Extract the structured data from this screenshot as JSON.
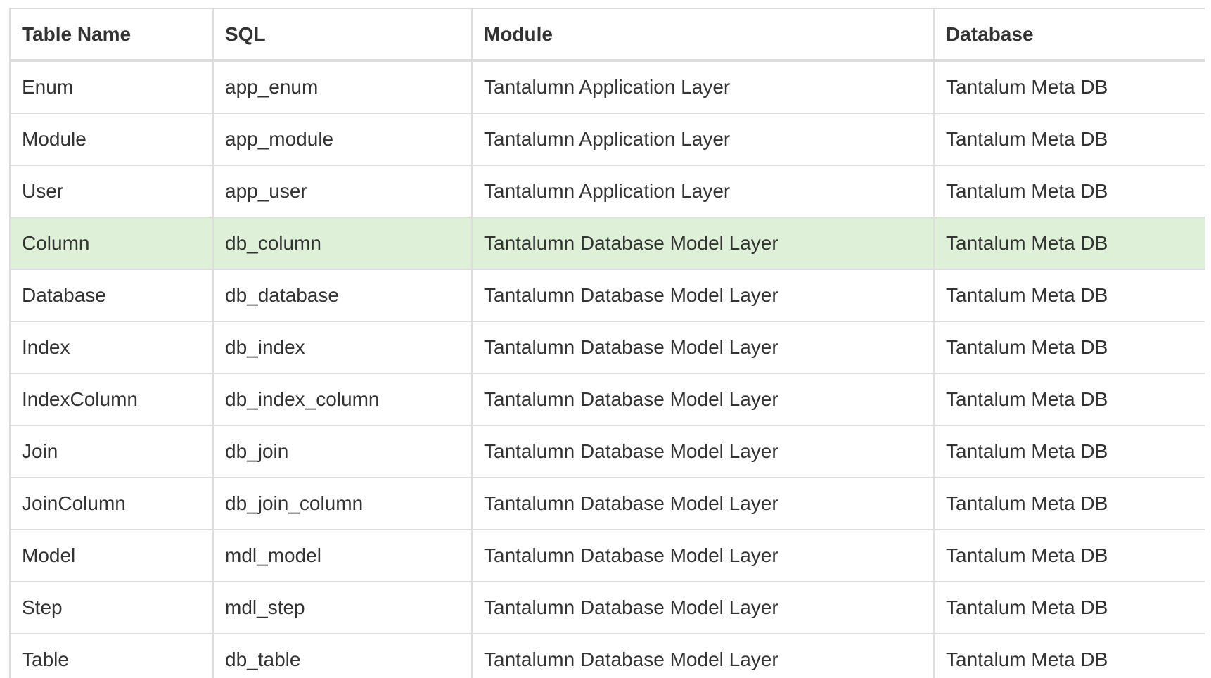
{
  "columns": {
    "table_name": "Table Name",
    "sql": "SQL",
    "module": "Module",
    "database": "Database"
  },
  "rows": [
    {
      "table_name": "Enum",
      "sql": "app_enum",
      "module": "Tantalumn Application Layer",
      "database": "Tantalum Meta DB",
      "highlighted": false
    },
    {
      "table_name": "Module",
      "sql": "app_module",
      "module": "Tantalumn Application Layer",
      "database": "Tantalum Meta DB",
      "highlighted": false
    },
    {
      "table_name": "User",
      "sql": "app_user",
      "module": "Tantalumn Application Layer",
      "database": "Tantalum Meta DB",
      "highlighted": false
    },
    {
      "table_name": "Column",
      "sql": "db_column",
      "module": "Tantalumn Database Model Layer",
      "database": "Tantalum Meta DB",
      "highlighted": true
    },
    {
      "table_name": "Database",
      "sql": "db_database",
      "module": "Tantalumn Database Model Layer",
      "database": "Tantalum Meta DB",
      "highlighted": false
    },
    {
      "table_name": "Index",
      "sql": "db_index",
      "module": "Tantalumn Database Model Layer",
      "database": "Tantalum Meta DB",
      "highlighted": false
    },
    {
      "table_name": "IndexColumn",
      "sql": "db_index_column",
      "module": "Tantalumn Database Model Layer",
      "database": "Tantalum Meta DB",
      "highlighted": false
    },
    {
      "table_name": "Join",
      "sql": "db_join",
      "module": "Tantalumn Database Model Layer",
      "database": "Tantalum Meta DB",
      "highlighted": false
    },
    {
      "table_name": "JoinColumn",
      "sql": "db_join_column",
      "module": "Tantalumn Database Model Layer",
      "database": "Tantalum Meta DB",
      "highlighted": false
    },
    {
      "table_name": "Model",
      "sql": "mdl_model",
      "module": "Tantalumn Database Model Layer",
      "database": "Tantalum Meta DB",
      "highlighted": false
    },
    {
      "table_name": "Step",
      "sql": "mdl_step",
      "module": "Tantalumn Database Model Layer",
      "database": "Tantalum Meta DB",
      "highlighted": false
    },
    {
      "table_name": "Table",
      "sql": "db_table",
      "module": "Tantalumn Database Model Layer",
      "database": "Tantalum Meta DB",
      "highlighted": false
    }
  ],
  "colors": {
    "border": "#dddddd",
    "highlight_row": "#dff0d8",
    "text": "#333333"
  }
}
